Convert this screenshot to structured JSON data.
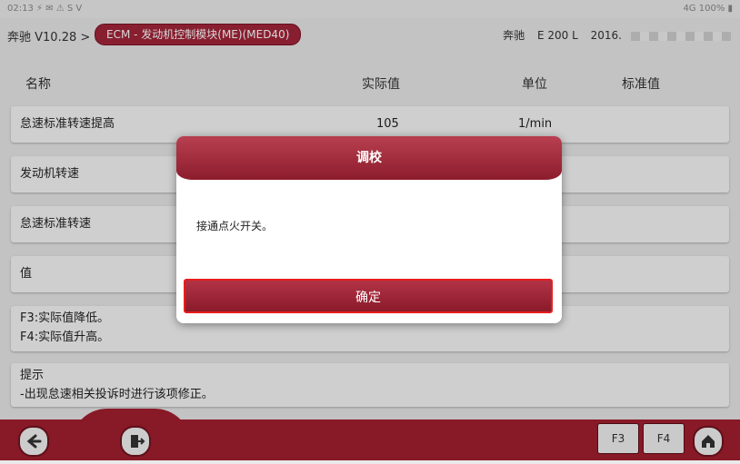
{
  "statusbar": {
    "left": "02:13  ⚡  ✉  ⚠ S V",
    "right": "4G 100% ▮"
  },
  "breadcrumb": {
    "path": "奔驰 V10.28 > >",
    "module": "ECM - 发动机控制模块(ME)(MED40)"
  },
  "vehicle": {
    "make": "奔驰",
    "model": "E 200 L",
    "year": "2016."
  },
  "table": {
    "headers": {
      "name": "名称",
      "value": "实际值",
      "unit": "单位",
      "standard": "标准值"
    },
    "rows": [
      {
        "name": "怠速标准转速提高",
        "value": "105",
        "unit": "1/min"
      },
      {
        "name": "发动机转速",
        "value": "",
        "unit": ""
      },
      {
        "name": "怠速标准转速",
        "value": "",
        "unit": ""
      },
      {
        "name": "值",
        "value": "",
        "unit": ""
      }
    ],
    "notes": {
      "line1": "F3:实际值降低。",
      "line2": "F4:实际值升高。"
    },
    "hint": {
      "line1": "提示",
      "line2": "-出现怠速相关投诉时进行该项修正。"
    }
  },
  "dialog": {
    "title": "调校",
    "message": "接通点火开关。",
    "ok_label": "确定"
  },
  "footer": {
    "back_icon": "back-arrow-icon",
    "exit_icon": "exit-door-icon",
    "f3_label": "F3",
    "f4_label": "F4",
    "home_icon": "home-icon"
  },
  "colors": {
    "brand": "#a21e2e",
    "dialog_button_border": "#e81d1d"
  }
}
